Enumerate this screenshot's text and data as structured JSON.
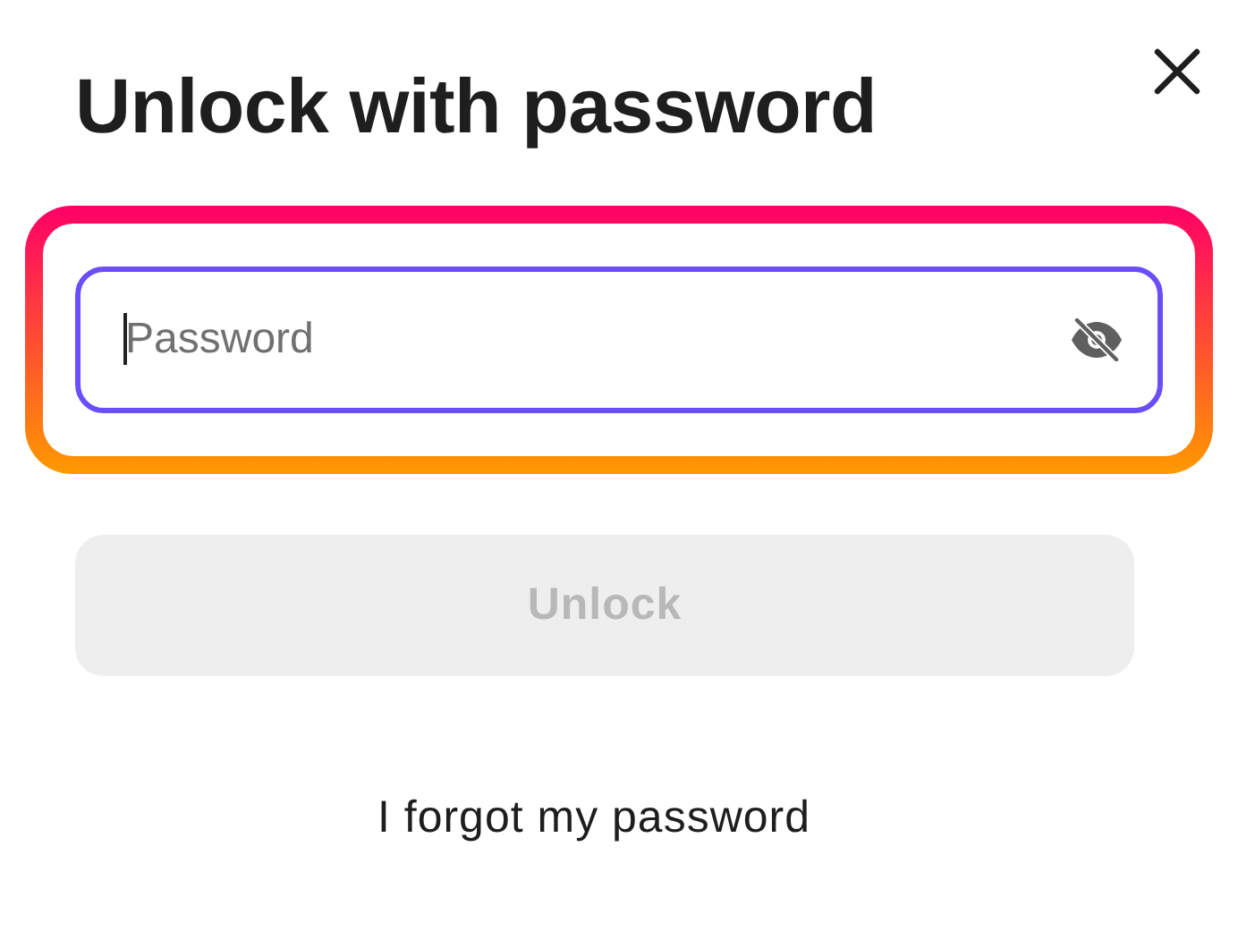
{
  "dialog": {
    "title": "Unlock with password"
  },
  "password_field": {
    "placeholder": "Password",
    "focused": true
  },
  "unlock_button": {
    "label": "Unlock",
    "disabled": true
  },
  "forgot_link": {
    "label": "I forgot my password"
  }
}
